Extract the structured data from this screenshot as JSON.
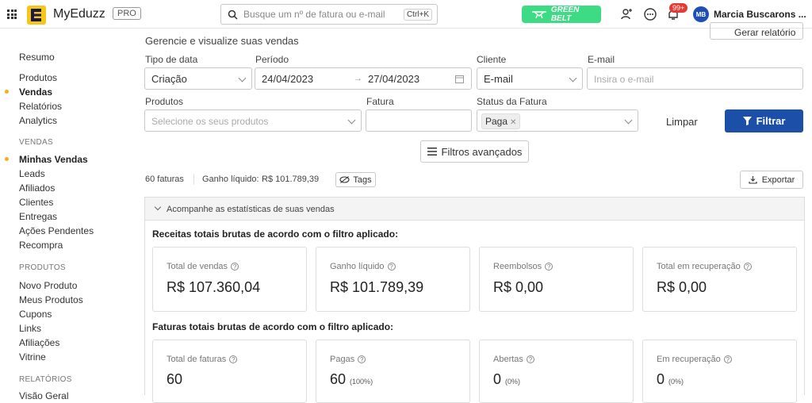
{
  "app": {
    "name": "MyEduzz",
    "plan_badge": "PRO"
  },
  "search": {
    "placeholder": "Busque um nº de fatura ou e-mail",
    "shortcut": "Ctrl+K"
  },
  "header": {
    "belt_label": "GREEN BELT",
    "notification_count": "99+",
    "avatar_initials": "MB",
    "user_name": "Marcia Buscarons ..."
  },
  "sidebar": {
    "top_items": [
      {
        "label": "Resumo"
      },
      {
        "label": "Produtos"
      },
      {
        "label": "Vendas",
        "active": true
      },
      {
        "label": "Relatórios"
      },
      {
        "label": "Analytics"
      }
    ],
    "sections": [
      {
        "title": "VENDAS",
        "items": [
          {
            "label": "Minhas Vendas",
            "active": true
          },
          {
            "label": "Leads"
          },
          {
            "label": "Afiliados"
          },
          {
            "label": "Clientes"
          },
          {
            "label": "Entregas"
          },
          {
            "label": "Ações Pendentes"
          },
          {
            "label": "Recompra"
          }
        ]
      },
      {
        "title": "PRODUTOS",
        "items": [
          {
            "label": "Novo Produto"
          },
          {
            "label": "Meus Produtos"
          },
          {
            "label": "Cupons"
          },
          {
            "label": "Links"
          },
          {
            "label": "Afiliações"
          },
          {
            "label": "Vitrine"
          }
        ]
      },
      {
        "title": "RELATÓRIOS",
        "items": [
          {
            "label": "Visão Geral"
          }
        ]
      }
    ]
  },
  "page": {
    "subtitle": "Gerencie e visualize suas vendas",
    "report_button": "Gerar relatório"
  },
  "filters": {
    "date_type": {
      "label": "Tipo de data",
      "value": "Criação"
    },
    "period": {
      "label": "Período",
      "start": "24/04/2023",
      "end": "27/04/2023"
    },
    "client": {
      "label": "Cliente",
      "value": "E-mail"
    },
    "email": {
      "label": "E-mail",
      "placeholder": "Insira o e-mail"
    },
    "products": {
      "label": "Produtos",
      "placeholder": "Selecione os seus produtos"
    },
    "invoice": {
      "label": "Fatura",
      "value": ""
    },
    "invoice_status": {
      "label": "Status da Fatura",
      "chip": "Paga"
    },
    "clear_button": "Limpar",
    "filter_button": "Filtrar",
    "advanced_button": "Filtros avançados"
  },
  "summary": {
    "invoices": "60 faturas",
    "net_gain_label": "Ganho líquido:",
    "net_gain_value": "R$ 101.789,39",
    "tags_button": "Tags",
    "export_button": "Exportar"
  },
  "stats": {
    "header": "Acompanhe as estatísticas de suas vendas",
    "revenue_title": "Receitas totais brutas de acordo com o filtro aplicado:",
    "revenue_cards": [
      {
        "label": "Total de vendas",
        "value": "R$ 107.360,04"
      },
      {
        "label": "Ganho líquido",
        "value": "R$ 101.789,39"
      },
      {
        "label": "Reembolsos",
        "value": "R$ 0,00"
      },
      {
        "label": "Total em recuperação",
        "value": "R$ 0,00"
      }
    ],
    "invoices_title": "Faturas totais brutas de acordo com o filtro aplicado:",
    "invoice_cards": [
      {
        "label": "Total de faturas",
        "value": "60",
        "pct": ""
      },
      {
        "label": "Pagas",
        "value": "60",
        "pct": "(100%)"
      },
      {
        "label": "Abertas",
        "value": "0",
        "pct": "(0%)"
      },
      {
        "label": "Em recuperação",
        "value": "0",
        "pct": "(0%)"
      }
    ]
  },
  "colors": {
    "accent": "#1c4fa8",
    "belt": "#3ddc84",
    "active_dot": "#f2b10f",
    "badge": "#e53935"
  }
}
